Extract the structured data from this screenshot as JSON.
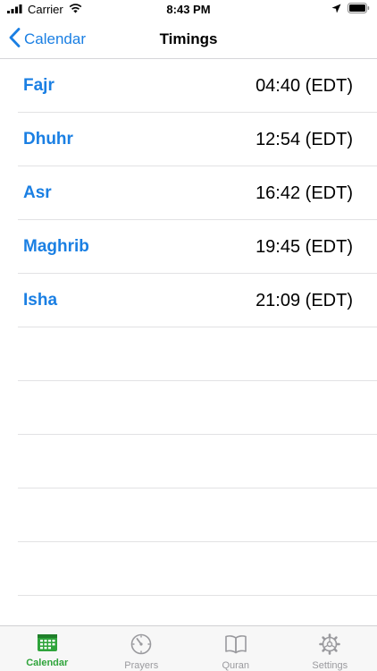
{
  "status_bar": {
    "carrier": "Carrier",
    "time": "8:43 PM"
  },
  "nav": {
    "back_label": "Calendar",
    "title": "Timings"
  },
  "prayers": [
    {
      "name": "Fajr",
      "time": "04:40 (EDT)"
    },
    {
      "name": "Dhuhr",
      "time": "12:54 (EDT)"
    },
    {
      "name": "Asr",
      "time": "16:42 (EDT)"
    },
    {
      "name": "Maghrib",
      "time": "19:45 (EDT)"
    },
    {
      "name": "Isha",
      "time": "21:09 (EDT)"
    }
  ],
  "tabs": [
    {
      "label": "Calendar",
      "icon": "calendar-icon",
      "active": true
    },
    {
      "label": "Prayers",
      "icon": "compass-icon",
      "active": false
    },
    {
      "label": "Quran",
      "icon": "book-icon",
      "active": false
    },
    {
      "label": "Settings",
      "icon": "gear-icon",
      "active": false
    }
  ],
  "colors": {
    "accent": "#1a7fe3",
    "tab_active": "#2fa43b",
    "tab_inactive": "#9a9a9e"
  }
}
